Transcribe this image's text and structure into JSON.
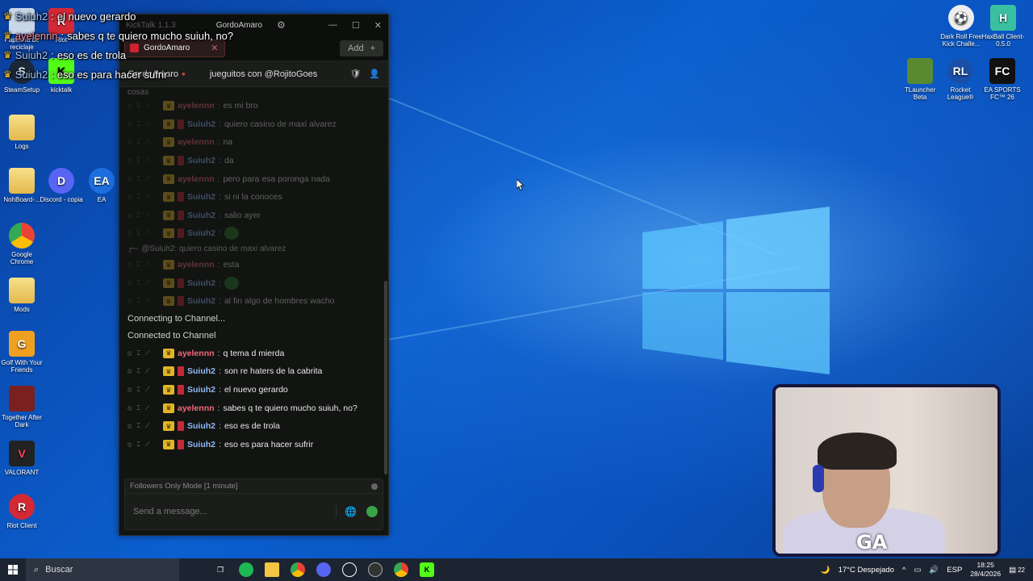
{
  "overlay": {
    "lines": [
      {
        "user": "Suiuh2",
        "text": "el nuevo gerardo"
      },
      {
        "user": "ayelennn",
        "text": "sabes q te quiero mucho suiuh, no?"
      },
      {
        "user": "Suiuh2",
        "text": "eso es de trola"
      },
      {
        "user": "Suiuh2",
        "text": "eso es para hacer sufrir"
      }
    ]
  },
  "kicktalk": {
    "title": "KickTalk 1.1.3",
    "username": "GordoAmaro",
    "tab_label": "GordoAmaro",
    "add_label": "Add",
    "channel": "GordoAmaro",
    "stream_title": "jueguitos con @RojitoGoes",
    "partial_top": "cosas",
    "old_messages": [
      {
        "user": "ayelennn",
        "text": "es mi bro"
      },
      {
        "user": "Suiuh2",
        "text": "quiero casino de maxi alvarez"
      },
      {
        "user": "ayelennn",
        "text": "na"
      },
      {
        "user": "Suiuh2",
        "text": "da"
      },
      {
        "user": "ayelennn",
        "text": "pero para esa poronga nada"
      },
      {
        "user": "Suiuh2",
        "text": "si ni la conoces"
      },
      {
        "user": "Suiuh2",
        "text": "salio ayer"
      },
      {
        "user": "Suiuh2",
        "text": ""
      }
    ],
    "reply_text": "@Suiuh2: quiero casino de maxi alvarez",
    "old_messages_2": [
      {
        "user": "ayelennn",
        "text": "esta"
      },
      {
        "user": "Suiuh2",
        "text": ""
      },
      {
        "user": "Suiuh2",
        "text": "al fin algo de hombres wacho"
      }
    ],
    "system_1": "Connecting to Channel...",
    "system_2": "Connected to Channel",
    "new_messages": [
      {
        "user": "ayelennn",
        "text": "q tema d mierda"
      },
      {
        "user": "Suiuh2",
        "text": "son re haters de la cabrita"
      },
      {
        "user": "Suiuh2",
        "text": "el nuevo gerardo"
      },
      {
        "user": "ayelennn",
        "text": "sabes q te quiero mucho suiuh, no?"
      },
      {
        "user": "Suiuh2",
        "text": "eso es de trola"
      },
      {
        "user": "Suiuh2",
        "text": "eso es para hacer sufrir"
      }
    ],
    "mode_text": "Followers Only Mode [1 minute]",
    "input_placeholder": "Send a message..."
  },
  "desktop_icons": {
    "left": [
      {
        "label": "Papelera de reciclaje"
      },
      {
        "label": "Riot"
      },
      {
        "label": "SteamSetup"
      },
      {
        "label": "kicktalk"
      },
      {
        "label": "Logs"
      },
      {
        "label": "NohBoard-..."
      },
      {
        "label": "Discord - copia"
      },
      {
        "label": "EA"
      },
      {
        "label": "Google Chrome"
      },
      {
        "label": "Mods"
      },
      {
        "label": "Golf With Your Friends"
      },
      {
        "label": "Together After Dark"
      },
      {
        "label": "VALORANT"
      },
      {
        "label": "Riot Client"
      }
    ],
    "right": [
      {
        "label": "Dark Roll Free Kick Challe..."
      },
      {
        "label": "HaxBall Client-0.5.0"
      },
      {
        "label": "TLauncher Beta"
      },
      {
        "label": "Rocket League®"
      },
      {
        "label": "EA SPORTS FC™ 26"
      }
    ]
  },
  "webcam": {
    "logo": "GA"
  },
  "taskbar": {
    "search_label": "Buscar",
    "weather": "17°C Despejado",
    "lang": "ESP",
    "time": "18:25",
    "date": "28/4/2026",
    "notif_count": "22"
  },
  "colors": {
    "suiuh_color": "#8fb8f5",
    "ayelen_color": "#f06a7a",
    "kick_green": "#53fc18"
  }
}
